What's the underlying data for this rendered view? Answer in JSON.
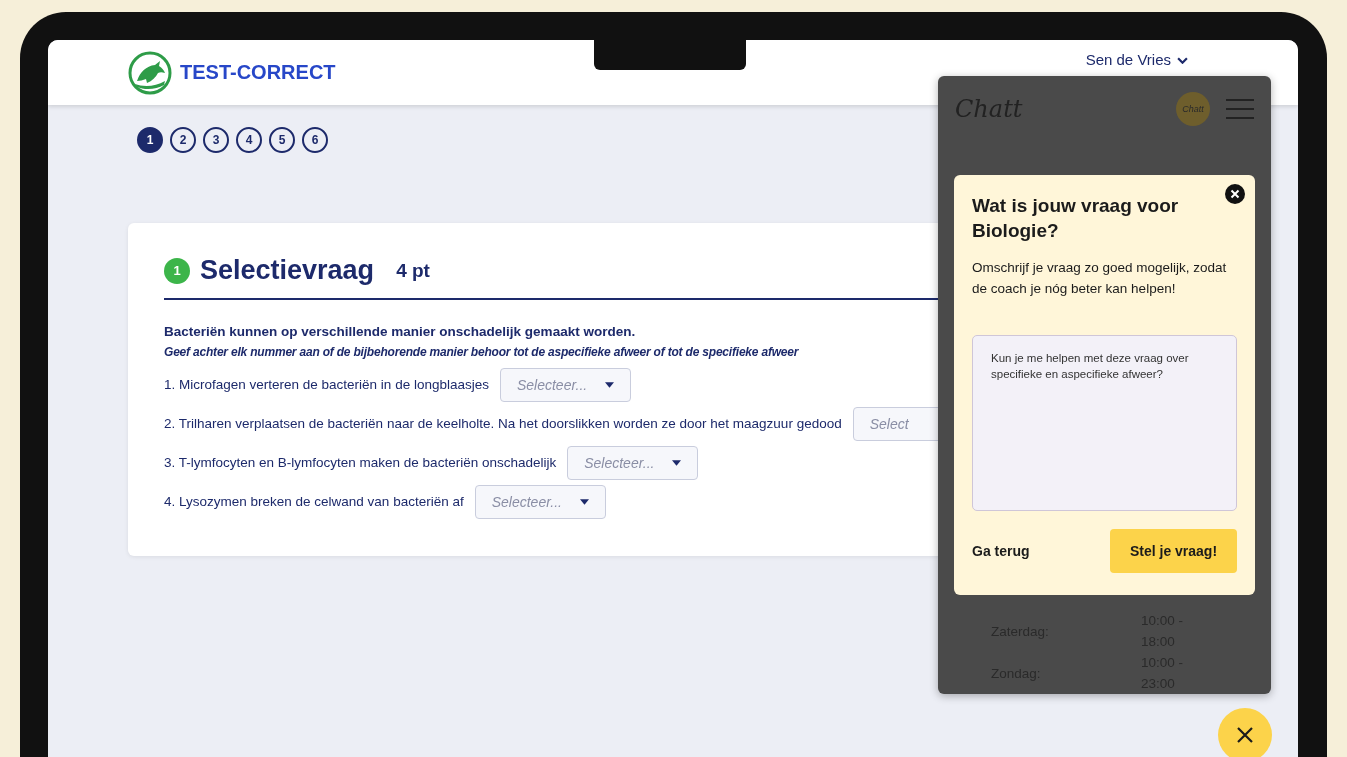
{
  "header": {
    "brand": "TEST-CORRECT",
    "user": "Sen de Vries"
  },
  "steps": [
    {
      "label": "1",
      "selected": true
    },
    {
      "label": "2",
      "selected": false
    },
    {
      "label": "3",
      "selected": false
    },
    {
      "label": "4",
      "selected": false
    },
    {
      "label": "5",
      "selected": false
    },
    {
      "label": "6",
      "selected": false
    }
  ],
  "question": {
    "number": "1",
    "title": "Selectievraag",
    "points": "4 pt",
    "intro": "Bacteriën kunnen op verschillende manier onschadelijk gemaakt worden.",
    "instruction": "Geef achter elk nummer aan of de bijbehorende manier behoor tot de aspecifieke afweer of tot de specifieke afweer",
    "items": [
      {
        "text": "1. Microfagen verteren de bacteriën in de longblaasjes",
        "placeholder": "Selecteer..."
      },
      {
        "text": "2. Trilharen verplaatsen de bacteriën naar de keelholte. Na het doorslikken worden ze door het maagzuur gedood",
        "placeholder": "Select"
      },
      {
        "text": "3. T-lymfocyten en B-lymfocyten maken de bacteriën onschadelijk",
        "placeholder": "Selecteer..."
      },
      {
        "text": "4. Lysozymen breken de celwand van bacteriën af",
        "placeholder": "Selecteer..."
      }
    ]
  },
  "chat": {
    "logo": "Chatt",
    "avatar": "Chatt",
    "modal": {
      "title": "Wat is jouw vraag voor Biologie?",
      "description": "Omschrijf je vraag zo goed mogelijk, zodat de coach je nóg beter kan helpen!",
      "question_value": "Kun je me helpen met deze vraag over specifieke en aspecifieke afweer?",
      "back": "Ga terug",
      "submit": "Stel je vraag!"
    },
    "schedule": [
      {
        "day": "Zaterdag:",
        "hours": "10:00 - 18:00"
      },
      {
        "day": "Zondag:",
        "hours": "10:00 - 23:00"
      }
    ]
  }
}
